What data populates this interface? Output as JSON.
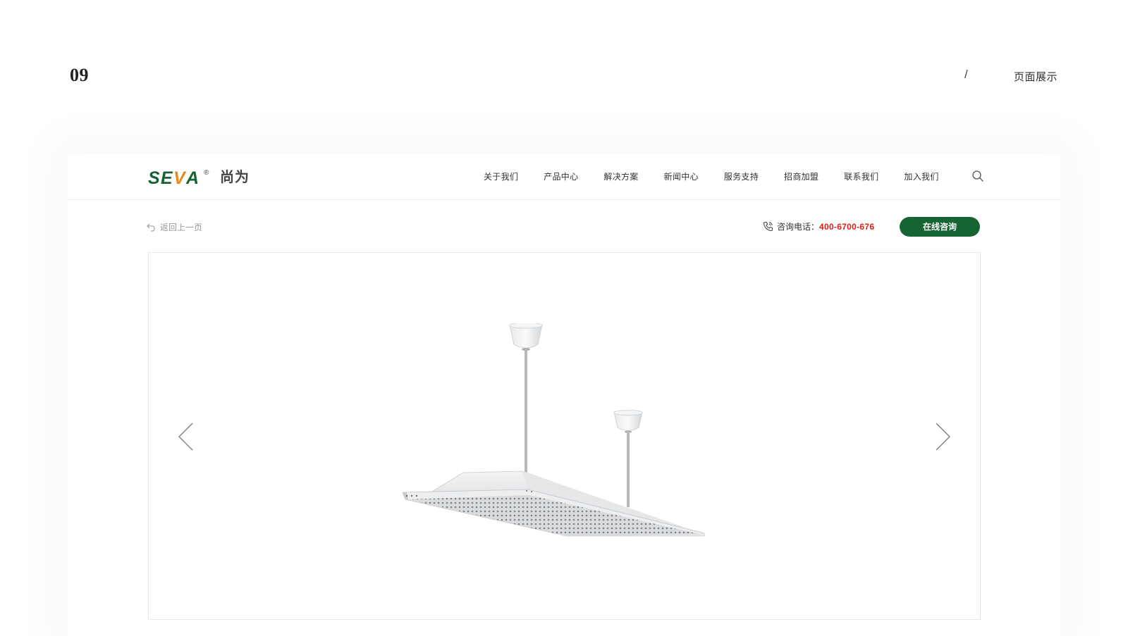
{
  "section": {
    "number": "09",
    "slash": "/",
    "title": "页面展示"
  },
  "site": {
    "logo": {
      "brand": "SEVA",
      "registered": "®",
      "cn": "尚为"
    },
    "nav": [
      "关于我们",
      "产品中心",
      "解决方案",
      "新闻中心",
      "服务支持",
      "招商加盟",
      "联系我们",
      "加入我们"
    ],
    "back": "返回上一页",
    "consult": {
      "label": "咨询电话：",
      "phone": "400-6700-676"
    },
    "consult_button": "在线咨询"
  },
  "colors": {
    "brand_green": "#166334",
    "logo_orange": "#e98a1e",
    "phone_red": "#d7201a"
  },
  "icons": {
    "search": "search-icon",
    "back": "back-arrow-icon",
    "phone": "phone-icon",
    "prev": "chevron-left-icon",
    "next": "chevron-right-icon"
  }
}
